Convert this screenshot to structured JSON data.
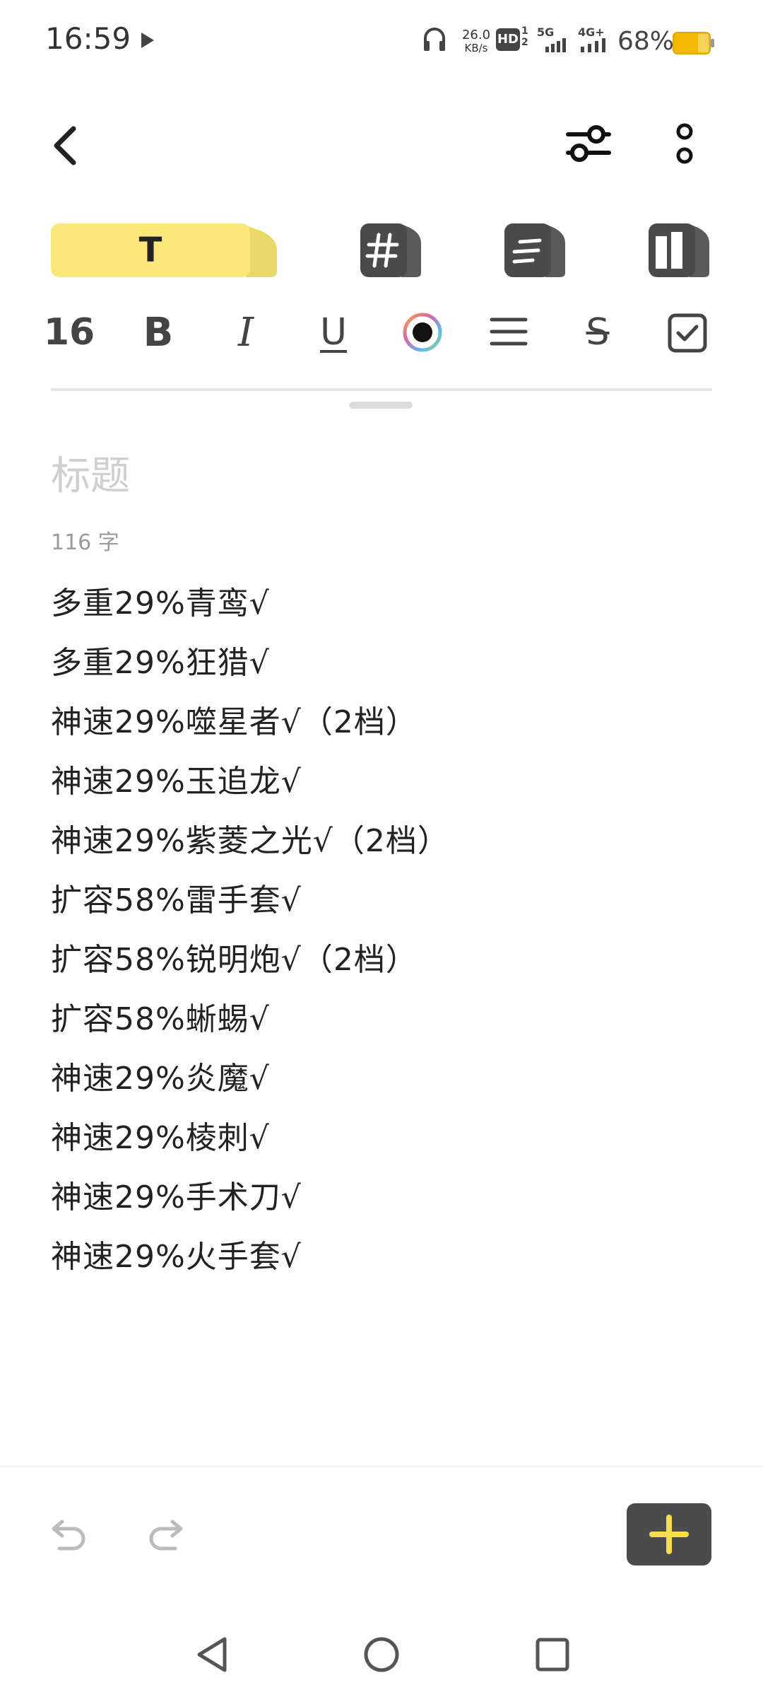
{
  "status_bar": {
    "time": "16:59",
    "net_speed_value": "26.0",
    "net_speed_unit": "KB/s",
    "hd_label": "HD",
    "network_5g": "5G",
    "network_4g": "4G+",
    "battery_percent": "68%",
    "battery_level": 0.68,
    "battery_color": "#f5b800"
  },
  "toolbar": {
    "font_size": "16",
    "bold_label": "B",
    "italic_label": "I",
    "underline_label": "U",
    "strike_label": "S"
  },
  "tabs": {
    "text_tab_label": "T",
    "accent_color": "#fbe77a"
  },
  "note": {
    "title_placeholder": "标题",
    "word_count": "116 字",
    "lines": [
      "多重29%青鸾√",
      "多重29%狂猎√",
      "神速29%噬星者√（2档）",
      "神速29%玉追龙√",
      "神速29%紫菱之光√（2档）",
      "扩容58%雷手套√",
      "扩容58%锐明炮√（2档）",
      "扩容58%蜥蜴√",
      "神速29%炎魔√",
      "神速29%棱刺√",
      "神速29%手术刀√",
      "神速29%火手套√"
    ]
  }
}
